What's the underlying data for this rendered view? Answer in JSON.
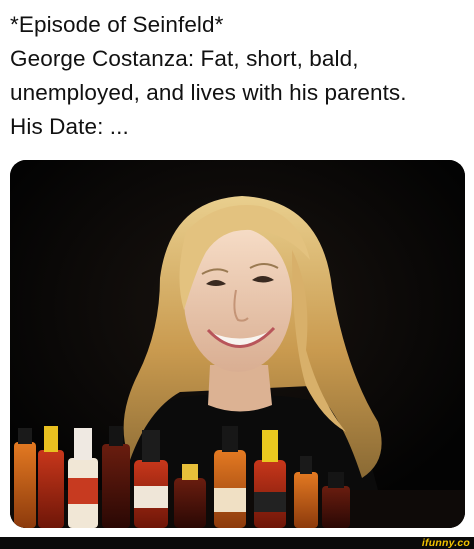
{
  "meme": {
    "caption_lines": [
      "*Episode of Seinfeld*",
      "George Costanza: Fat, short, bald,",
      "unemployed, and lives with his parents.",
      "His Date: ..."
    ],
    "photo_description_icon": "smiling-woman-hot-sauce-photo",
    "watermark": "ifunny.co"
  },
  "colors": {
    "background": "#ffffff",
    "text": "#111111",
    "photo_bg": "#040404",
    "watermark": "#f2c200"
  }
}
